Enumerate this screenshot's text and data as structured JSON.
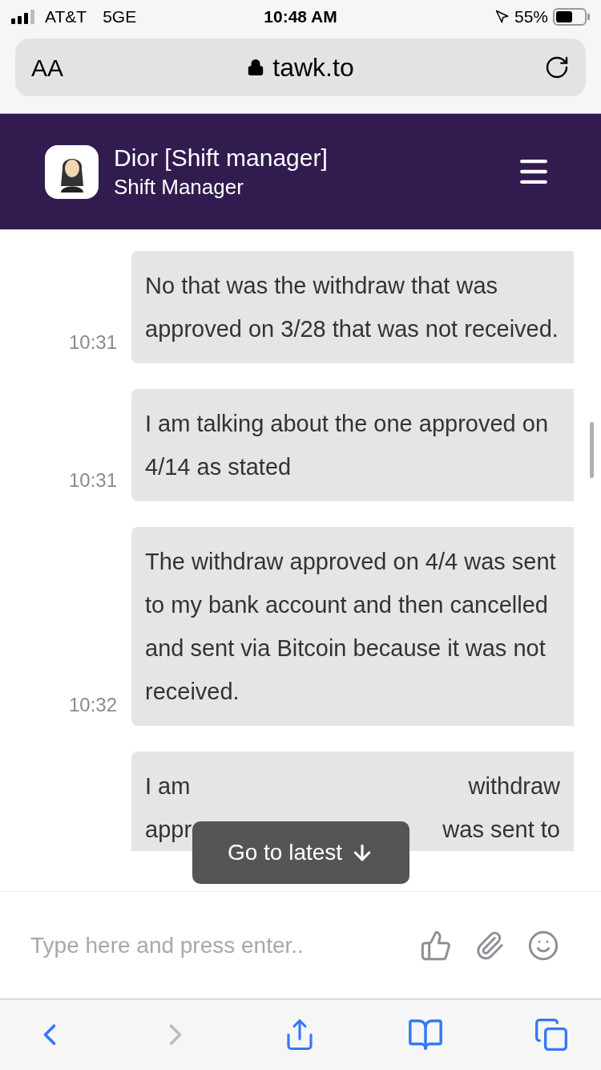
{
  "status_bar": {
    "carrier": "AT&T",
    "network": "5GE",
    "time": "10:48 AM",
    "battery": "55%"
  },
  "address_bar": {
    "text_size": "AA",
    "url": "tawk.to"
  },
  "header": {
    "name": "Dior [Shift manager]",
    "role": "Shift Manager"
  },
  "messages": [
    {
      "text": "No that was the withdraw that was approved on 3/28 that was not received.",
      "time": "10:31"
    },
    {
      "text": "I am talking about the one approved on 4/14 as stated",
      "time": "10:31"
    },
    {
      "text": "The withdraw approved on 4/4 was sent to my bank account and then cancelled and sent via Bitcoin because it was not received.",
      "time": "10:32"
    }
  ],
  "partial_message": {
    "lines": [
      {
        "left": "I am",
        "right": "withdraw"
      },
      {
        "left": "appr",
        "right": "was sent to"
      }
    ]
  },
  "latest_button": {
    "label": "Go to latest"
  },
  "composer": {
    "placeholder": "Type here and press enter.."
  },
  "toolbar": {
    "back": {
      "disabled": false
    },
    "forward": {
      "disabled": true
    }
  }
}
